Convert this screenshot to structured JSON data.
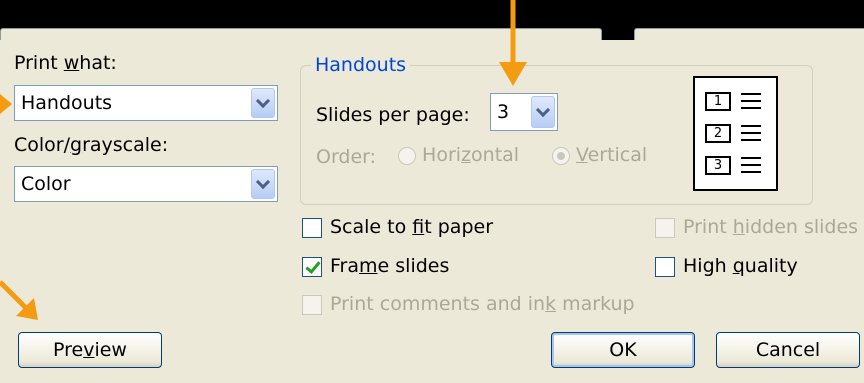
{
  "print_what": {
    "label": "Print what:",
    "value": "Handouts"
  },
  "color": {
    "label": "Color/grayscale:",
    "value": "Color"
  },
  "handouts": {
    "title": "Handouts",
    "slides_per_page_label": "Slides per page:",
    "slides_per_page_value": "3",
    "order_label": "Order:",
    "horizontal": "Horizontal",
    "vertical": "Vertical",
    "selected_order": "Vertical",
    "preview_slots": [
      "1",
      "2",
      "3"
    ]
  },
  "options": {
    "scale_to_fit": {
      "label": "Scale to fit paper",
      "checked": false
    },
    "frame_slides": {
      "label": "Frame slides",
      "checked": true
    },
    "print_comments": {
      "label": "Print comments and ink markup",
      "checked": false,
      "enabled": false
    },
    "print_hidden": {
      "label": "Print hidden slides",
      "checked": false,
      "enabled": false
    },
    "high_quality": {
      "label": "High quality",
      "checked": false
    }
  },
  "buttons": {
    "preview": "Preview",
    "ok": "OK",
    "cancel": "Cancel"
  },
  "colors": {
    "dialog_bg": "#ece9d8",
    "group_title": "#0046d5",
    "annotation_arrow": "#f39c12"
  }
}
